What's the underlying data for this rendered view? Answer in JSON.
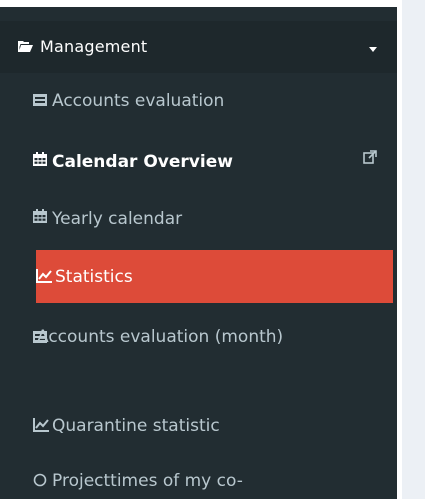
{
  "sidebar": {
    "section": {
      "label": "Management",
      "icon": "folder-open-icon"
    },
    "items": [
      {
        "label": "Accounts evaluation",
        "icon": "list-alt-icon"
      },
      {
        "label": "Calendar Overview",
        "icon": "calendar-icon",
        "external_icon": "external-link-icon"
      },
      {
        "label": "Yearly calendar",
        "icon": "calendar-icon"
      },
      {
        "label": "Statistics",
        "icon": "line-chart-icon"
      },
      {
        "label": "Accounts evaluation (month)",
        "icon": "list-alt-icon"
      },
      {
        "label": "Quarantine statistic",
        "icon": "line-chart-icon"
      },
      {
        "label": "Projecttimes of my co-",
        "icon": "circle-icon"
      }
    ]
  },
  "colors": {
    "sidebar_bg": "#222d32",
    "section_header_bg": "#1e282c",
    "active_bg": "#dd4b39",
    "text_muted": "#b8c7ce",
    "content_bg": "#ecf0f5"
  }
}
